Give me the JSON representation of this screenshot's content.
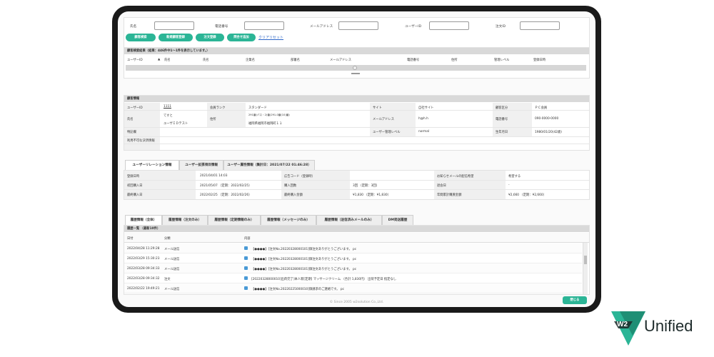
{
  "search": {
    "labels": [
      "氏名",
      "電話番号",
      "メールアドレス",
      "ユーザーID",
      "注文ID"
    ],
    "buttons": [
      "顧客検索",
      "新規顧客登録",
      "注文登録",
      "問合せ追加"
    ],
    "links": [
      "クリア",
      "リセット"
    ]
  },
  "results": {
    "title": "顧客検索結果（結果：446件中1〜1件を表示しています。）",
    "columns": [
      "ユーザーID",
      "▲",
      "氏名",
      "氏名",
      "企業名",
      "部署名",
      "メールアドレス",
      "電話番号",
      "住所",
      "管理レベル",
      "登録日時"
    ]
  },
  "customer": {
    "section_title": "顧客情報",
    "user_id_label": "ユーザーID",
    "user_id": "1111",
    "rank_label": "会員ランク",
    "rank": "スタンダード",
    "site_label": "サイト",
    "site": "自社サイト",
    "type_label": "顧客区分",
    "type": "ＰＣ会員",
    "name_label": "氏名",
    "name1": "てすと",
    "name2": "ユーザＩＤテスト",
    "address_label": "住所",
    "address1": "291番(バス・2)番(291-0番(10)番)",
    "address2": "福岡県福岡市福岡町１１",
    "email_label": "メールアドレス",
    "email": "h@h.h",
    "phone_label": "電話番号",
    "phone": "090-0000-0000",
    "special_label": "特記欄",
    "level_label": "ユーザー管理レベル",
    "level": "normal",
    "birth_label": "生年月日",
    "birth": "1980/01/20(42歳)",
    "payment_label": "利用不可な決済情報"
  },
  "relation_tabs": [
    "ユーザーリレーション情報",
    "ユーザー拡張項目情報",
    "ユーザー属性情報（集計日：2021/07/22 01:46:28）"
  ],
  "relation": {
    "reg_label": "登録日時",
    "reg": "2021/04/01 14:03",
    "ad_label": "広告コード（登録時）",
    "ad": "",
    "notify_label": "お知らせメールの配信希望",
    "notify": "希望する",
    "first_label": "初回購入日",
    "first": "2021/05/07 （定期：2022/02/25）",
    "count_label": "購入回数",
    "count": "3回 （定期：3回）",
    "return_label": "退会日",
    "return": "-",
    "last_label": "最終購入日",
    "last": "2022/02/25 （定期：2022/02/26）",
    "amount_label": "最終購入金額",
    "amount": "¥1,830 （定期：¥1,830）",
    "annual_label": "年間累計購買金額",
    "annual": "¥2,660 （定期：¥2,660）"
  },
  "history_tabs": [
    "履歴情報（全体）",
    "履歴情報（注文のみ）",
    "履歴情報（定期情報のみ）",
    "履歴情報（メッセージのみ）",
    "履歴情報（送信済みメールのみ）",
    "DM発送履歴"
  ],
  "history": {
    "title": "履歴一覧 （最新10件）",
    "columns": [
      "日付",
      "分類",
      "内容"
    ],
    "rows": [
      {
        "date": "2022/04/28 11:29:28",
        "type": "メール送信",
        "content": "【●●●●】[注文No.20220328000101]御注文ありがとうございます。 pc"
      },
      {
        "date": "2022/03/29 15:30:23",
        "type": "メール送信",
        "content": "【●●●●】[注文No.20220328000101]御注文ありがとうございます。 pc"
      },
      {
        "date": "2022/03/28 09:34:33",
        "type": "メール送信",
        "content": "【●●●●】[注文No.20220328000101]御注文ありがとうございます。 pc"
      },
      {
        "date": "2022/03/28 09:34:32",
        "type": "注文",
        "content": "[20220328000010]出荷完了]本人新[定期] マッサージクリーム （合計 1,830円） 出荷予定日 指定なし"
      },
      {
        "date": "2022/02/22 19:49:21",
        "type": "メール送信",
        "content": "【●●●●】[注文No.20220225000010]御請求のご連絡です。 pc"
      }
    ]
  },
  "close_button": "閉じる",
  "footer": "© Since 2005 w2solution Co.,Ltd.",
  "logo": {
    "mark": "W2",
    "text": "Unified",
    "color": "#2bb596"
  }
}
